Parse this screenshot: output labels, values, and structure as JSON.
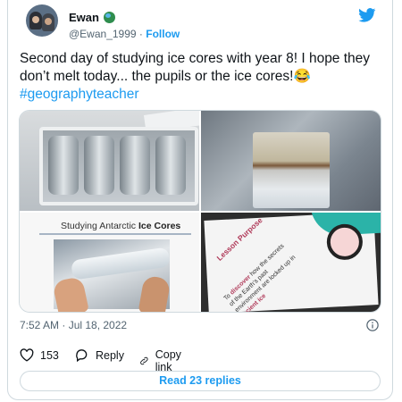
{
  "tweet": {
    "author_name": "Ewan",
    "author_handle": "@Ewan_1999",
    "separator": "·",
    "follow_label": "Follow",
    "text_line": "Second day of studying ice cores with year 8! I hope they don’t melt today... the pupils or the ice cores!",
    "emoji": "😂",
    "hashtag": "#geographyteacher",
    "timestamp": "7:52 AM · Jul 18, 2022",
    "likes_count": "153",
    "reply_label": "Reply",
    "copy_link_label": "Copy link",
    "read_replies_label": "Read 23 replies"
  },
  "media": {
    "slide1_title_prefix": "Studying Antarctic ",
    "slide1_title_bold": "Ice Cores",
    "slide2_title": "Lesson Purpose",
    "slide2_text_prefix": "To ",
    "slide2_text_bold1": "discover",
    "slide2_text_mid": " how the secrets of the Earth’s past environment are locked up in ",
    "slide2_text_bold2": "ancient ice"
  },
  "colors": {
    "accent": "#1d9bf0",
    "text": "#0f1419",
    "secondary_text": "#536471",
    "border": "#cfd9de"
  },
  "icons": {
    "brand": "twitter-bird-icon",
    "verified": "globe-icon",
    "like": "heart-icon",
    "reply": "speech-bubble-icon",
    "copy": "link-icon",
    "info": "info-icon"
  }
}
